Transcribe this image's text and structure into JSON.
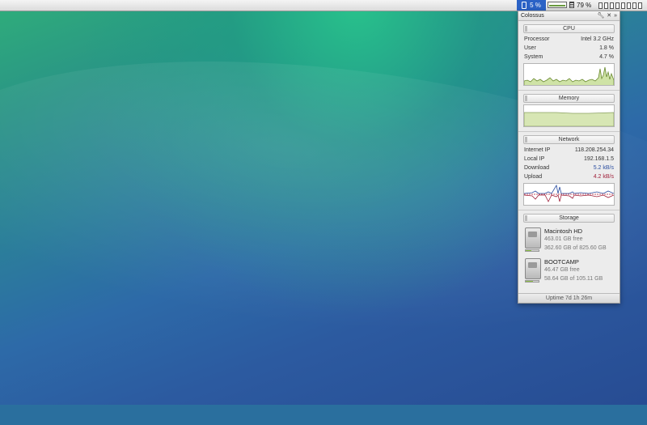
{
  "menubar": {
    "cpu_label": "5 %",
    "battery_label": "79 %"
  },
  "panel": {
    "title": "Colossus",
    "icons": [
      "wrench-icon",
      "close-icon",
      "expand-icon"
    ],
    "cpu": {
      "heading": "CPU",
      "rows": [
        {
          "label": "Processor",
          "value": "Intel 3.2 GHz"
        },
        {
          "label": "User",
          "value": "1.8 %"
        },
        {
          "label": "System",
          "value": "4.7 %"
        }
      ]
    },
    "memory": {
      "heading": "Memory"
    },
    "network": {
      "heading": "Network",
      "rows": [
        {
          "label": "Internet IP",
          "value": "118.208.254.34"
        },
        {
          "label": "Local IP",
          "value": "192.168.1.5"
        },
        {
          "label": "Download",
          "value": "5.2 kB/s"
        },
        {
          "label": "Upload",
          "value": "4.2 kB/s"
        }
      ]
    },
    "storage": {
      "heading": "Storage",
      "drives": [
        {
          "name": "Macintosh HD",
          "free": "463.01 GB free",
          "total": "362.60 GB of 825.60 GB",
          "used_fraction": 0.44
        },
        {
          "name": "BOOTCAMP",
          "free": "46.47 GB free",
          "total": "58.64 GB of 105.11 GB",
          "used_fraction": 0.56
        }
      ]
    },
    "footer": "Uptime 7d 1h 26m"
  },
  "colors": {
    "accent_blue": "#2b62c6",
    "graph_green": "#8ec04a",
    "download_blue": "#2b4ea0",
    "upload_red": "#a0203a"
  }
}
